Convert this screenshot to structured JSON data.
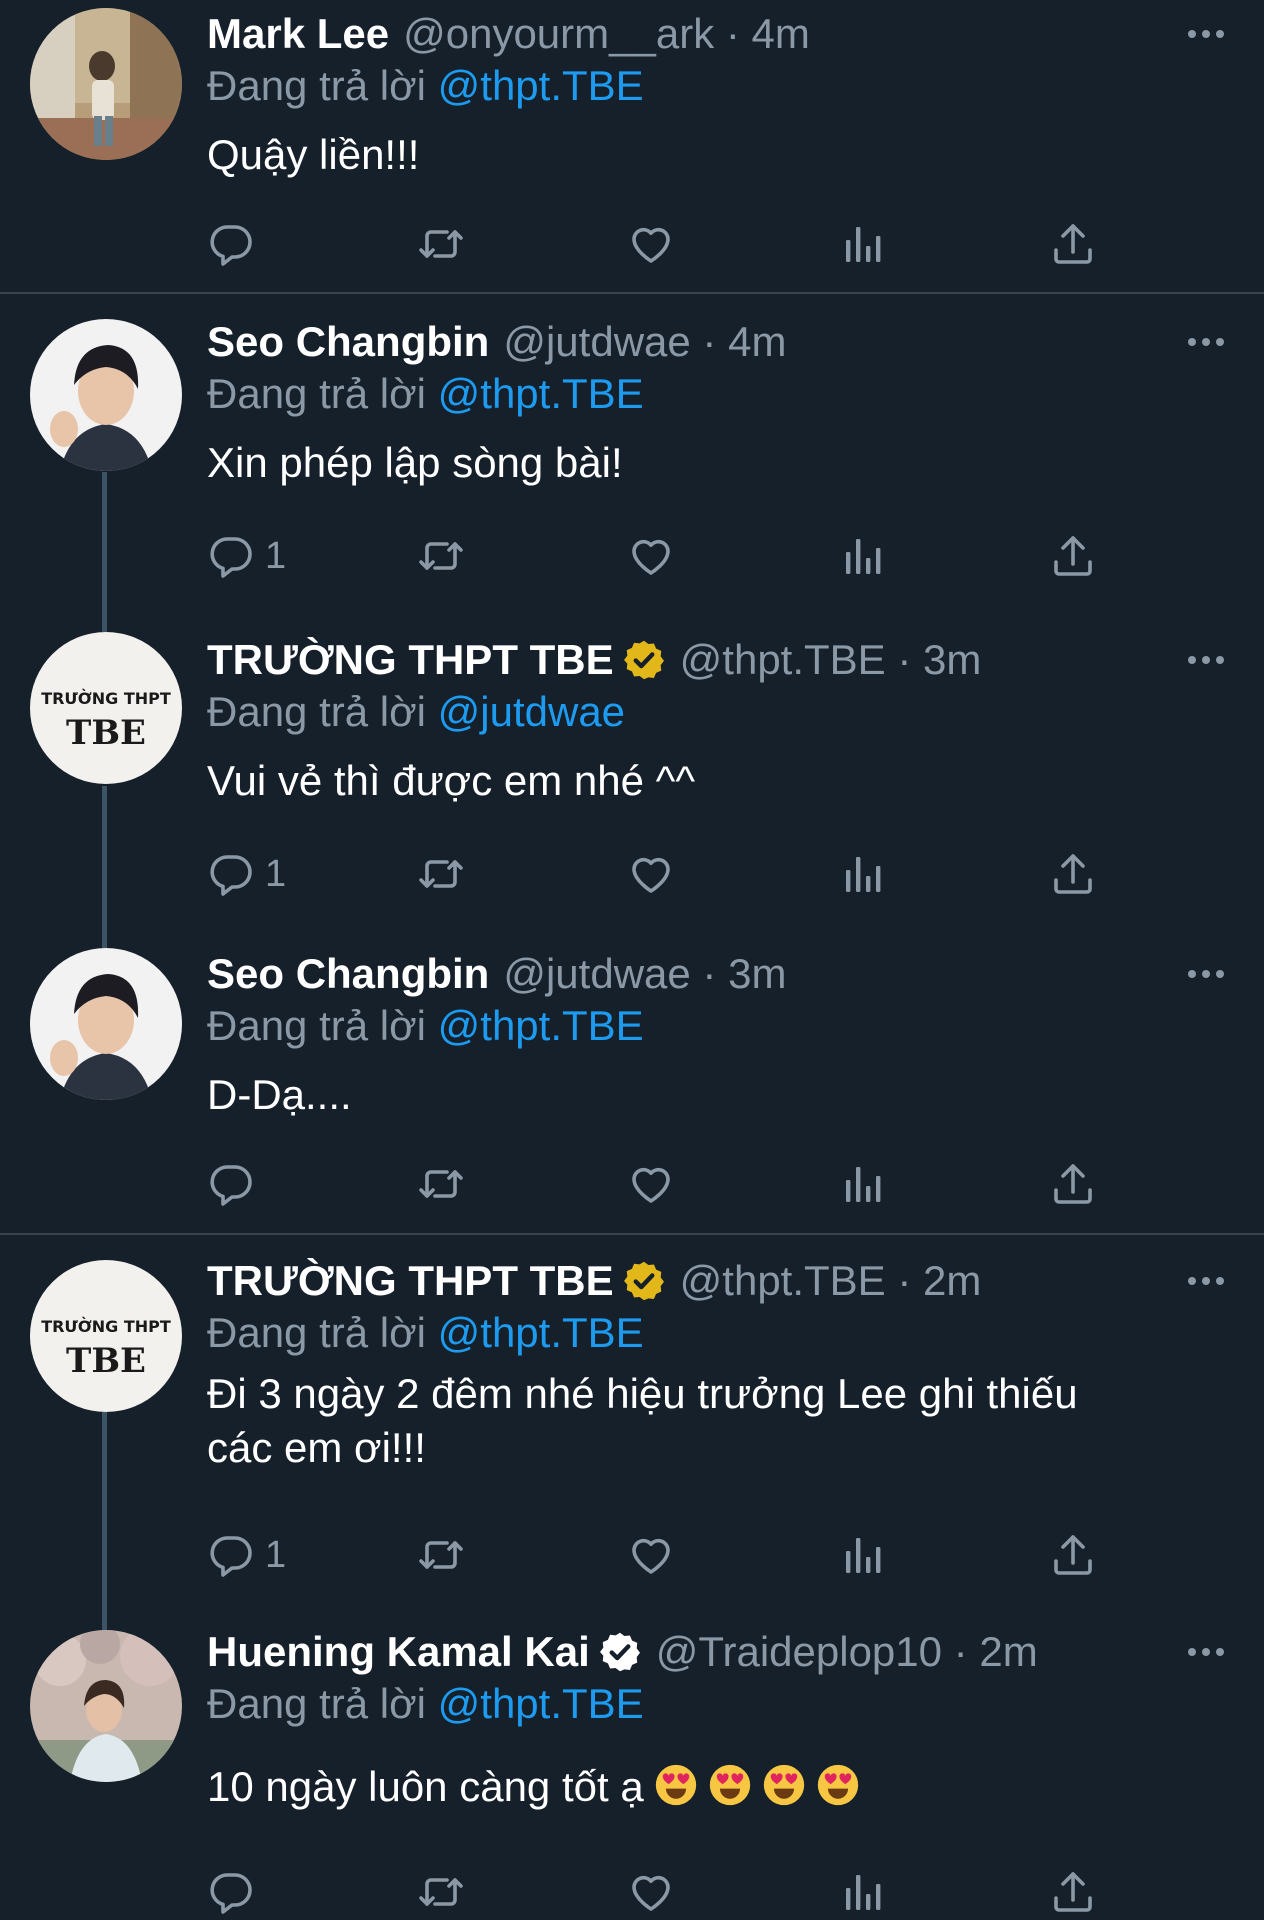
{
  "tweets": [
    {
      "name": "Mark Lee",
      "handle": "@onyourm__ark",
      "time": "4m",
      "replying_prefix": "Đang trả lời",
      "replying_to": "@thpt.TBE",
      "text_lines": [
        "Quậy liền!!!"
      ],
      "reply_count": "",
      "verified": false,
      "avatar": "mark-lee-photo-avatar"
    },
    {
      "name": "Seo Changbin",
      "handle": "@jutdwae",
      "time": "4m",
      "replying_prefix": "Đang trả lời",
      "replying_to": "@thpt.TBE",
      "text_lines": [
        "Xin phép lập sòng bài!"
      ],
      "reply_count": "1",
      "verified": false,
      "avatar": "seo-changbin-photo-avatar"
    },
    {
      "name": "TRƯỜNG THPT TBE",
      "handle": "@thpt.TBE",
      "time": "3m",
      "replying_prefix": "Đang trả lời",
      "replying_to": "@jutdwae",
      "text_lines": [
        "Vui vẻ thì được em nhé ^^"
      ],
      "reply_count": "1",
      "verified": "gold",
      "avatar": "school-logo-avatar",
      "logo_text_top": "TRƯỜNG THPT",
      "logo_text_bottom": "TBE"
    },
    {
      "name": "Seo Changbin",
      "handle": "@jutdwae",
      "time": "3m",
      "replying_prefix": "Đang trả lời",
      "replying_to": "@thpt.TBE",
      "text_lines": [
        "D-Dạ...."
      ],
      "reply_count": "",
      "verified": false,
      "avatar": "seo-changbin-photo-avatar"
    },
    {
      "name": "TRƯỜNG THPT TBE",
      "handle": "@thpt.TBE",
      "time": "2m",
      "replying_prefix": "Đang trả lời",
      "replying_to": "@thpt.TBE",
      "text_lines": [
        "Đi 3 ngày 2 đêm nhé hiệu trưởng Lee ghi thiếu",
        "các em ơi!!!"
      ],
      "reply_count": "1",
      "verified": "gold",
      "avatar": "school-logo-avatar",
      "logo_text_top": "TRƯỜNG THPT",
      "logo_text_bottom": "TBE"
    },
    {
      "name": "Huening Kamal Kai",
      "handle": "@Traideplop10",
      "time": "2m",
      "replying_prefix": "Đang trả lời",
      "replying_to": "@thpt.TBE",
      "text_lines": [
        "10 ngày luôn càng tốt ạ"
      ],
      "emojis": [
        "heart-eyes-emoji",
        "heart-eyes-emoji",
        "heart-eyes-emoji",
        "heart-eyes-emoji"
      ],
      "reply_count": "",
      "verified": "white",
      "avatar": "huening-kai-photo-avatar"
    }
  ],
  "separator": "·",
  "colors": {
    "background": "#15202b",
    "divider": "#38444d",
    "secondary_text": "#8b98a5",
    "link": "#1d9bf0",
    "gold_badge": "#e2b719"
  },
  "icons": [
    "reply-icon",
    "retweet-icon",
    "like-icon",
    "analytics-icon",
    "share-icon",
    "more-icon"
  ]
}
